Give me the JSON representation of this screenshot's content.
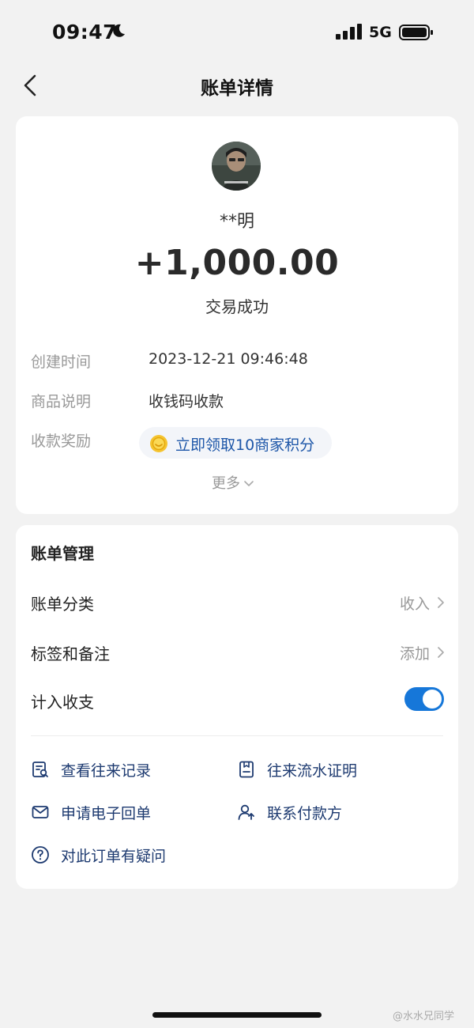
{
  "status_bar": {
    "time": "09:47",
    "network": "5G"
  },
  "nav": {
    "title": "账单详情"
  },
  "transaction": {
    "payer": "**明",
    "amount": "+1,000.00",
    "status": "交易成功",
    "details": [
      {
        "label": "创建时间",
        "value": "2023-12-21 09:46:48"
      },
      {
        "label": "商品说明",
        "value": "收钱码收款"
      },
      {
        "label": "收款奖励",
        "value": "立即领取10商家积分"
      }
    ],
    "more": "更多"
  },
  "management": {
    "title": "账单管理",
    "rows": [
      {
        "label": "账单分类",
        "value": "收入"
      },
      {
        "label": "标签和备注",
        "value": "添加"
      },
      {
        "label": "计入收支",
        "toggle": true
      }
    ],
    "actions": [
      {
        "label": "查看往来记录",
        "icon": "records-icon"
      },
      {
        "label": "往来流水证明",
        "icon": "certificate-icon"
      },
      {
        "label": "申请电子回单",
        "icon": "mail-icon"
      },
      {
        "label": "联系付款方",
        "icon": "contact-icon"
      },
      {
        "label": "对此订单有疑问",
        "icon": "question-icon"
      }
    ]
  },
  "watermark": "@水水兄同学",
  "colors": {
    "accent": "#1677d9",
    "link": "#1d3a70",
    "background": "#f2f2f2"
  }
}
